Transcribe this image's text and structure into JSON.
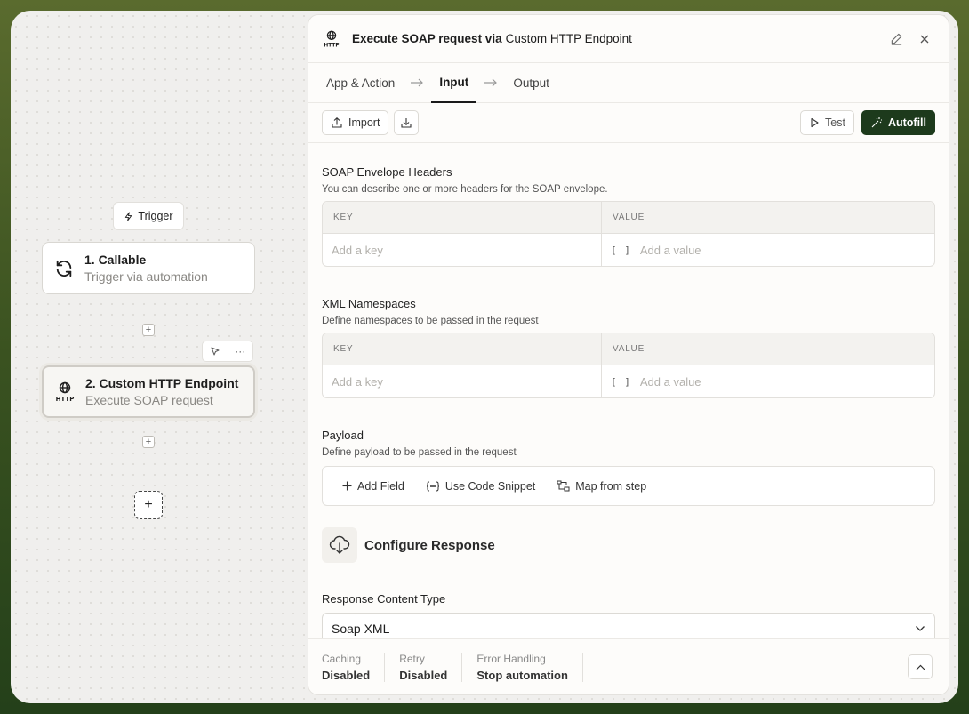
{
  "canvas": {
    "trigger_label": "Trigger",
    "nodes": [
      {
        "title": "1. Callable",
        "subtitle": "Trigger via automation"
      },
      {
        "title": "2. Custom HTTP Endpoint",
        "subtitle": "Execute SOAP request"
      }
    ],
    "node_toolbar_more": "···"
  },
  "panel": {
    "title": "Execute SOAP request via",
    "title_app": "Custom HTTP Endpoint",
    "tabs": [
      {
        "label": "App & Action"
      },
      {
        "label": "Input"
      },
      {
        "label": "Output"
      }
    ],
    "toolbar": {
      "import_label": "Import",
      "test_label": "Test",
      "autofill_label": "Autofill"
    },
    "sections": {
      "headers": {
        "title": "SOAP Envelope Headers",
        "desc": "You can describe one or more headers for the SOAP envelope.",
        "key_header": "KEY",
        "value_header": "VALUE",
        "key_placeholder": "Add a key",
        "value_placeholder": "Add a value",
        "bracket": "[ ]"
      },
      "namespaces": {
        "title": "XML Namespaces",
        "desc": "Define namespaces to be passed in the request",
        "key_header": "KEY",
        "value_header": "VALUE",
        "key_placeholder": "Add a key",
        "value_placeholder": "Add a value",
        "bracket": "[ ]"
      },
      "payload": {
        "title": "Payload",
        "desc": "Define payload to be passed in the request",
        "add_field": "Add Field",
        "use_code_snippet": "Use Code Snippet",
        "map_from_step": "Map from step"
      },
      "configure_response": {
        "title": "Configure Response",
        "content_type_label": "Response Content Type",
        "content_type_value": "Soap XML"
      }
    },
    "footer": {
      "caching_label": "Caching",
      "caching_value": "Disabled",
      "retry_label": "Retry",
      "retry_value": "Disabled",
      "error_label": "Error Handling",
      "error_value": "Stop automation"
    }
  }
}
